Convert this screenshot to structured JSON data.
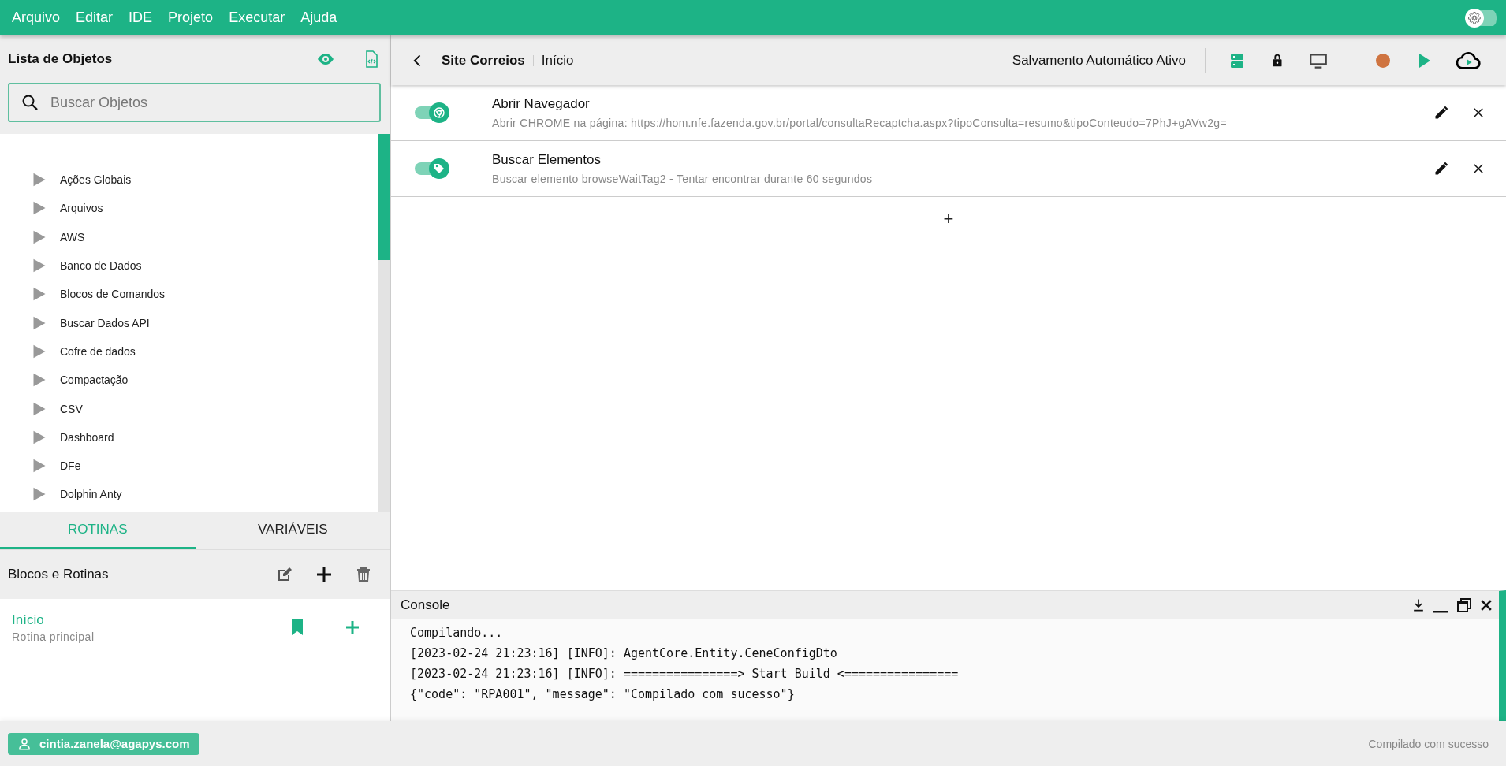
{
  "menu_bar": {
    "items": [
      "Arquivo",
      "Editar",
      "IDE",
      "Projeto",
      "Executar",
      "Ajuda"
    ],
    "settings_toggle": {
      "on": false
    }
  },
  "object_list": {
    "title": "Lista de Objetos",
    "search": {
      "placeholder": "Buscar Objetos"
    },
    "items": [
      "Ações Globais",
      "Arquivos",
      "AWS",
      "Banco de Dados",
      "Blocos de Comandos",
      "Buscar Dados API",
      "Cofre de dados",
      "Compactação",
      "CSV",
      "Dashboard",
      "DFe",
      "Dolphin Anty"
    ]
  },
  "tabs": [
    {
      "label": "ROTINAS",
      "selected": true
    },
    {
      "label": "VARIÁVEIS",
      "selected": false
    }
  ],
  "routines": {
    "title": "Blocos e Rotinas",
    "items": [
      {
        "name": "Início",
        "description": "Rotina principal"
      }
    ]
  },
  "user": {
    "email": "cintia.zanela@agapys.com"
  },
  "toolbar": {
    "breadcrumb": [
      "Site Correios",
      "Início"
    ],
    "autosave": "Salvamento Automático Ativo"
  },
  "steps": [
    {
      "kind": "browser",
      "enabled": true,
      "title": "Abrir Navegador",
      "description": "Abrir CHROME na página: https://hom.nfe.fazenda.gov.br/portal/consultaRecaptcha.aspx?tipoConsulta=resumo&tipoConteudo=7PhJ+gAVw2g="
    },
    {
      "kind": "tag",
      "enabled": true,
      "title": "Buscar Elementos",
      "description": "Buscar elemento browseWaitTag2 - Tentar encontrar durante 60 segundos"
    }
  ],
  "add_step": "+",
  "console": {
    "title": "Console",
    "lines": [
      "Compilando...",
      "[2023-02-24 21:23:16] [INFO]: AgentCore.Entity.CeneConfigDto",
      "[2023-02-24 21:23:16] [INFO]: ================> Start Build <================",
      "{\"code\": \"RPA001\", \"message\": \"Compilado com sucesso\"}"
    ]
  },
  "status_bar": {
    "message": "Compilado com sucesso"
  }
}
